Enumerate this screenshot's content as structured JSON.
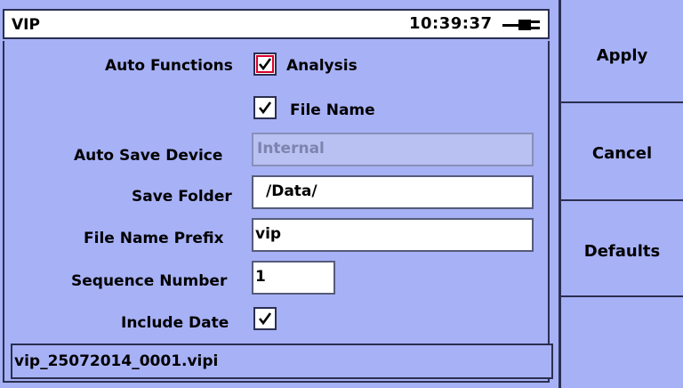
{
  "window": {
    "title": "VIP",
    "time": "10:39:37"
  },
  "form": {
    "auto_functions_label": "Auto Functions",
    "analysis_label": "Analysis",
    "analysis_checked": true,
    "file_name_label": "File Name",
    "file_name_checked": true,
    "auto_save_device_label": "Auto Save Device",
    "auto_save_device_value": "Internal",
    "save_folder_label": "Save Folder",
    "save_folder_value": "/Data/",
    "file_name_prefix_label": "File Name Prefix",
    "file_name_prefix_value": "vip",
    "sequence_number_label": "Sequence Number",
    "sequence_number_value": "1",
    "include_date_label": "Include Date",
    "include_date_checked": true,
    "filename_preview": "vip_25072014_0001.vipi"
  },
  "softkeys": {
    "apply": "Apply",
    "cancel": "Cancel",
    "defaults": "Defaults",
    "empty": ""
  },
  "icons": {
    "power": "plug-icon",
    "checkbox": "checkmark-icon"
  },
  "colors": {
    "panel_bg": "#a7b1f6",
    "focus_outline": "#d9002c"
  }
}
